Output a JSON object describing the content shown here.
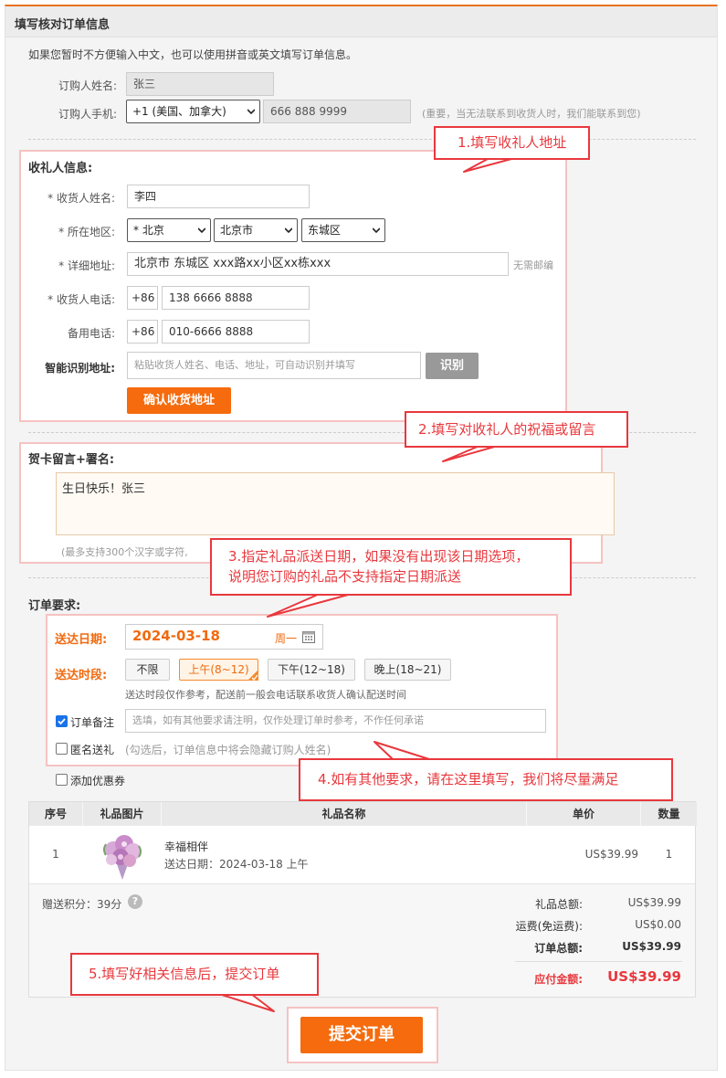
{
  "page": {
    "title": "填写核对订单信息",
    "intro": "如果您暂时不方便输入中文，也可以使用拼音或英文填写订单信息。"
  },
  "orderer": {
    "name_label": "订购人姓名:",
    "name_value": "张三",
    "phone_label": "订购人手机:",
    "country_code": "+1 (美国、加拿大)",
    "phone_value": "666 888 9999",
    "phone_note": "(重要，当无法联系到收货人时，我们能联系到您)"
  },
  "recipient": {
    "section_title": "收礼人信息:",
    "name_label": "* 收货人姓名:",
    "name_value": "李四",
    "region_label": "* 所在地区:",
    "province": "* 北京",
    "city": "北京市",
    "district": "东城区",
    "address_label": "* 详细地址:",
    "address_value": "北京市 东城区  xxx路xx小区xx栋xxx",
    "no_zip": "无需邮编",
    "phone_label": "* 收货人电话:",
    "phone_prefix": "+86",
    "phone_value": "138 6666 8888",
    "alt_phone_label": "备用电话:",
    "alt_phone_prefix": "+86",
    "alt_phone_value": "010-6666 8888",
    "smart_label": "智能识别地址:",
    "smart_placeholder": "粘贴收货人姓名、电话、地址，可自动识别并填写",
    "recognize_button": "识别",
    "confirm_button": "确认收货地址"
  },
  "card": {
    "section_title": "贺卡留言+署名:",
    "message": "生日快乐！张三",
    "hint": "(最多支持300个汉字或字符,"
  },
  "order_req": {
    "section_title": "订单要求:",
    "date_label": "送达日期:",
    "date_value": "2024-03-18",
    "weekday": "周一",
    "time_label": "送达时段:",
    "slots": [
      "不限",
      "上午(8~12)",
      "下午(12~18)",
      "晚上(18~21)"
    ],
    "time_note": "送达时段仅作参考，配送前一般会电话联系收货人确认配送时间",
    "remark_label": "订单备注",
    "remark_placeholder": "选填，如有其他要求请注明，仅作处理订单时参考，不作任何承诺",
    "anonymous_label": "匿名送礼",
    "anonymous_note": "(勾选后，订单信息中将会隐藏订购人姓名)",
    "coupon_label": "添加优惠券"
  },
  "table": {
    "headers": [
      "序号",
      "礼品图片",
      "礼品名称",
      "单价",
      "数量"
    ],
    "rows": [
      {
        "index": "1",
        "name": "幸福相伴",
        "delivery": "送达日期：2024-03-18 上午",
        "price": "US$39.99",
        "qty": "1"
      }
    ]
  },
  "summary": {
    "points": "赠送积分：39分",
    "subtotal_label": "礼品总额:",
    "subtotal_value": "US$39.99",
    "shipping_label": "运费(免运费):",
    "shipping_value": "US$0.00",
    "total_label": "订单总额:",
    "total_value": "US$39.99",
    "payable_label": "应付金额:",
    "payable_value": "US$39.99"
  },
  "submit_button": "提交订单",
  "callouts": {
    "c1": "1.填写收礼人地址",
    "c2": "2.填写对收礼人的祝福或留言",
    "c3_line1": "3.指定礼品派送日期，如果没有出现该日期选项，",
    "c3_line2": "说明您订购的礼品不支持指定日期派送",
    "c4": "4.如有其他要求，请在这里填写，我们将尽量满足",
    "c5": "5.填写好相关信息后，提交订单"
  },
  "colors": {
    "accent": "#f56b0d",
    "callout_red": "#e8383d",
    "highlight_border": "#f6c2c2"
  }
}
